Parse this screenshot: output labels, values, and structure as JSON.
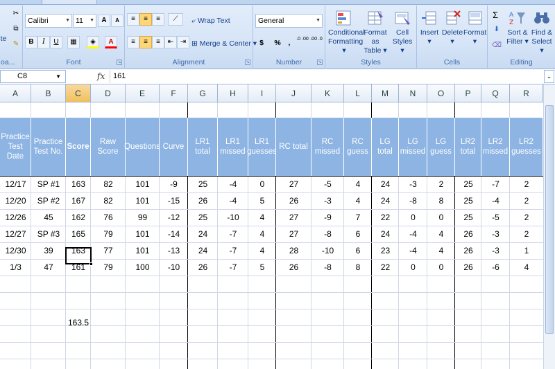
{
  "ribbon": {
    "font": {
      "name": "Calibri",
      "size": "11",
      "grow": "A",
      "shrink": "A",
      "bold": "B",
      "italic": "I",
      "underline": "U",
      "label": "Font"
    },
    "alignment": {
      "wrap_text": "Wrap Text",
      "merge_center": "Merge & Center",
      "label": "Alignment"
    },
    "number": {
      "format": "General",
      "currency": "$",
      "percent": "%",
      "comma": ",",
      "inc_dec": ".0 .00",
      "dec_dec": ".00 .0",
      "label": "Number"
    },
    "styles": {
      "conditional": [
        "Conditional",
        "Formatting"
      ],
      "format_table": [
        "Format as",
        "Table"
      ],
      "cell_styles": [
        "Cell",
        "Styles"
      ],
      "label": "Styles"
    },
    "cells": {
      "insert": "Insert",
      "delete": "Delete",
      "format": "Format",
      "label": "Cells"
    },
    "editing": {
      "sort_filter": [
        "Sort &",
        "Filter"
      ],
      "find_select": [
        "Find &",
        "Select"
      ],
      "sigma": "Σ",
      "label": "Editing"
    },
    "clipboard": {
      "label": "oa...",
      "paste_label": "te"
    }
  },
  "formula_bar": {
    "name_box": "C8",
    "fx": "fx",
    "value": "161"
  },
  "sheet": {
    "columns": [
      "A",
      "B",
      "C",
      "D",
      "E",
      "F",
      "G",
      "H",
      "I",
      "J",
      "K",
      "L",
      "M",
      "N",
      "O",
      "P",
      "Q",
      "R"
    ],
    "headers": [
      "Practice Test Date",
      "Practice Test No.",
      "Score",
      "Raw Score",
      "Questions",
      "Curve",
      "LR1 total",
      "LR1 missed",
      "LR1 guesses",
      "RC total",
      "RC missed",
      "RC guess",
      "LG total",
      "LG missed",
      "LG guess",
      "LR2 total",
      "LR2 missed",
      "LR2 guesses"
    ],
    "rows": [
      [
        "12/17",
        "SP #1",
        "163",
        "82",
        "101",
        "-9",
        "25",
        "-4",
        "0",
        "27",
        "-5",
        "4",
        "24",
        "-3",
        "2",
        "25",
        "-7",
        "2"
      ],
      [
        "12/20",
        "SP #2",
        "167",
        "82",
        "101",
        "-15",
        "26",
        "-4",
        "5",
        "26",
        "-3",
        "4",
        "24",
        "-8",
        "8",
        "25",
        "-4",
        "2"
      ],
      [
        "12/26",
        "45",
        "162",
        "76",
        "99",
        "-12",
        "25",
        "-10",
        "4",
        "27",
        "-9",
        "7",
        "22",
        "0",
        "0",
        "25",
        "-5",
        "2"
      ],
      [
        "12/27",
        "SP #3",
        "165",
        "79",
        "101",
        "-14",
        "24",
        "-7",
        "4",
        "27",
        "-8",
        "6",
        "24",
        "-4",
        "4",
        "26",
        "-3",
        "2"
      ],
      [
        "12/30",
        "39",
        "163",
        "77",
        "101",
        "-13",
        "24",
        "-7",
        "4",
        "28",
        "-10",
        "6",
        "23",
        "-4",
        "4",
        "26",
        "-3",
        "1"
      ],
      [
        "1/3",
        "47",
        "161",
        "79",
        "100",
        "-10",
        "26",
        "-7",
        "5",
        "26",
        "-8",
        "8",
        "22",
        "0",
        "0",
        "26",
        "-6",
        "4"
      ]
    ],
    "average": "163.5"
  },
  "colors": {
    "header_fill": "#8db4e3",
    "ribbon": "#d7e5f7",
    "selection": "#f1c15f"
  }
}
